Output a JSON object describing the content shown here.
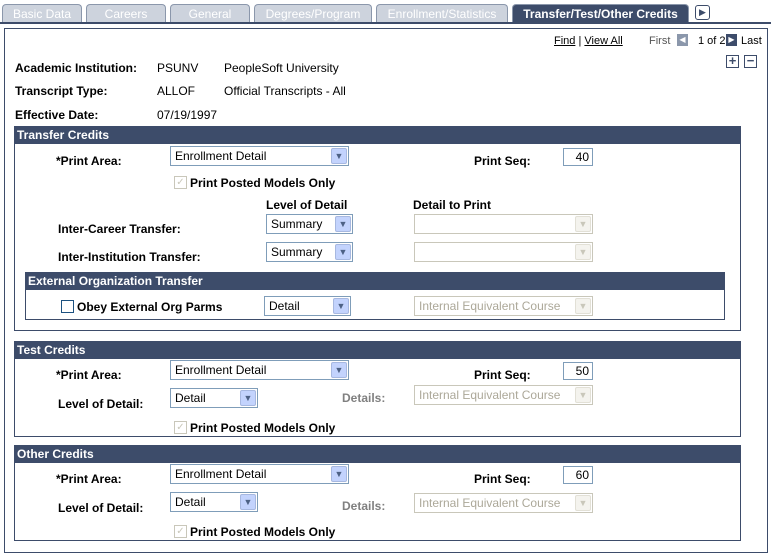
{
  "tabs": [
    {
      "label": "Basic Data"
    },
    {
      "label": "Careers"
    },
    {
      "label": "General"
    },
    {
      "label": "Degrees/Program"
    },
    {
      "label": "Enrollment/Statistics"
    },
    {
      "label": "Transfer/Test/Other Credits"
    }
  ],
  "nav": {
    "find": "Find",
    "separator": "|",
    "view_all": "View All",
    "first": "First",
    "page_indicator": "1 of 2",
    "last": "Last"
  },
  "header": {
    "academic_institution_label": "Academic Institution:",
    "academic_institution_code": "PSUNV",
    "academic_institution_name": "PeopleSoft University",
    "transcript_type_label": "Transcript Type:",
    "transcript_type_code": "ALLOF",
    "transcript_type_name": "Official Transcripts - All",
    "effective_date_label": "Effective Date:",
    "effective_date": "07/19/1997"
  },
  "transfer": {
    "title": "Transfer Credits",
    "print_area_label": "*Print Area:",
    "print_area_value": "Enrollment Detail",
    "print_seq_label": "Print Seq:",
    "print_seq_value": "40",
    "posted_models_label": "Print Posted Models Only",
    "level_of_detail_header": "Level of Detail",
    "detail_to_print_header": "Detail to Print",
    "inter_career_label": "Inter-Career Transfer:",
    "inter_career_level": "Summary",
    "inter_career_detail": "",
    "inter_institution_label": "Inter-Institution Transfer:",
    "inter_institution_level": "Summary",
    "inter_institution_detail": "",
    "ext_org": {
      "title": "External Organization Transfer",
      "obey_label": "Obey External Org Parms",
      "level_value": "Detail",
      "detail_value": "Internal Equivalent Course"
    }
  },
  "test": {
    "title": "Test Credits",
    "print_area_label": "*Print Area:",
    "print_area_value": "Enrollment Detail",
    "print_seq_label": "Print Seq:",
    "print_seq_value": "50",
    "level_label": "Level of Detail:",
    "level_value": "Detail",
    "details_label": "Details:",
    "details_value": "Internal Equivalent Course",
    "posted_models_label": "Print Posted Models Only"
  },
  "other": {
    "title": "Other Credits",
    "print_area_label": "*Print Area:",
    "print_area_value": "Enrollment Detail",
    "print_seq_label": "Print Seq:",
    "print_seq_value": "60",
    "level_label": "Level of Detail:",
    "level_value": "Detail",
    "details_label": "Details:",
    "details_value": "Internal Equivalent Course",
    "posted_models_label": "Print Posted Models Only"
  },
  "colors": {
    "header_blue": "#3d4c6a",
    "inactive_tab": "#cdd3dd"
  }
}
